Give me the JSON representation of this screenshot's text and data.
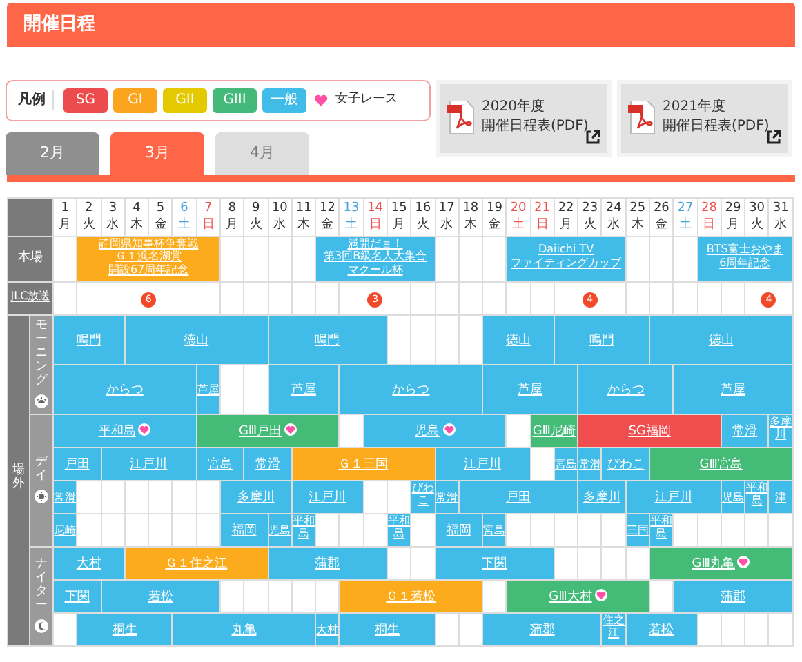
{
  "page_title": "開催日程",
  "legend": {
    "label": "凡例",
    "grades": [
      {
        "label": "SG",
        "color": "#ec4c4e"
      },
      {
        "label": "GI",
        "color": "#fba41e"
      },
      {
        "label": "GII",
        "color": "#e4c900"
      },
      {
        "label": "GIII",
        "color": "#45b97a"
      },
      {
        "label": "一般",
        "color": "#41bbe8"
      }
    ],
    "ladies": "女子レース"
  },
  "pdf_links": [
    {
      "year": "2020年度",
      "label": "開催日程表(PDF)"
    },
    {
      "year": "2021年度",
      "label": "開催日程表(PDF)"
    }
  ],
  "month_tabs": [
    {
      "label": "2月",
      "selected": false,
      "disabled": false
    },
    {
      "label": "3月",
      "selected": true,
      "disabled": false
    },
    {
      "label": "4月",
      "selected": false,
      "disabled": true
    }
  ],
  "days": [
    {
      "day": "1",
      "weekday": "月",
      "kind": "weekday"
    },
    {
      "day": "2",
      "weekday": "火",
      "kind": "weekday"
    },
    {
      "day": "3",
      "weekday": "水",
      "kind": "weekday"
    },
    {
      "day": "4",
      "weekday": "木",
      "kind": "weekday"
    },
    {
      "day": "5",
      "weekday": "金",
      "kind": "weekday"
    },
    {
      "day": "6",
      "weekday": "土",
      "kind": "saturday"
    },
    {
      "day": "7",
      "weekday": "日",
      "kind": "holiday"
    },
    {
      "day": "8",
      "weekday": "月",
      "kind": "weekday"
    },
    {
      "day": "9",
      "weekday": "火",
      "kind": "weekday"
    },
    {
      "day": "10",
      "weekday": "水",
      "kind": "weekday"
    },
    {
      "day": "11",
      "weekday": "木",
      "kind": "weekday"
    },
    {
      "day": "12",
      "weekday": "金",
      "kind": "weekday"
    },
    {
      "day": "13",
      "weekday": "土",
      "kind": "saturday"
    },
    {
      "day": "14",
      "weekday": "日",
      "kind": "holiday"
    },
    {
      "day": "15",
      "weekday": "月",
      "kind": "weekday"
    },
    {
      "day": "16",
      "weekday": "火",
      "kind": "weekday"
    },
    {
      "day": "17",
      "weekday": "水",
      "kind": "weekday"
    },
    {
      "day": "18",
      "weekday": "木",
      "kind": "weekday"
    },
    {
      "day": "19",
      "weekday": "金",
      "kind": "weekday"
    },
    {
      "day": "20",
      "weekday": "土",
      "kind": "holiday"
    },
    {
      "day": "21",
      "weekday": "日",
      "kind": "holiday"
    },
    {
      "day": "22",
      "weekday": "月",
      "kind": "weekday"
    },
    {
      "day": "23",
      "weekday": "火",
      "kind": "weekday"
    },
    {
      "day": "24",
      "weekday": "水",
      "kind": "weekday"
    },
    {
      "day": "25",
      "weekday": "木",
      "kind": "weekday"
    },
    {
      "day": "26",
      "weekday": "金",
      "kind": "weekday"
    },
    {
      "day": "27",
      "weekday": "土",
      "kind": "saturday"
    },
    {
      "day": "28",
      "weekday": "日",
      "kind": "holiday"
    },
    {
      "day": "29",
      "weekday": "月",
      "kind": "weekday"
    },
    {
      "day": "30",
      "weekday": "火",
      "kind": "weekday"
    },
    {
      "day": "31",
      "weekday": "水",
      "kind": "weekday"
    }
  ],
  "home": {
    "label": "本場",
    "cells": [
      "",
      {
        "colspan": 6,
        "kind": "gi",
        "lines": [
          "静岡県知事杯争奪戦",
          "Ｇ１浜名湖賞",
          "開設67周年記念"
        ]
      },
      "",
      "",
      "",
      "",
      {
        "colspan": 5,
        "kind": "general",
        "lines": [
          "満開だョ！",
          "第3回B級名人大集合",
          "マクール杯"
        ]
      },
      "",
      "",
      "",
      {
        "colspan": 5,
        "kind": "general",
        "lines": [
          "Daiichi TV",
          "ファイティングカップ"
        ]
      },
      "",
      "",
      "",
      {
        "colspan": 4,
        "kind": "general",
        "lines": [
          "BTS富士おやま",
          "6周年記念"
        ]
      }
    ]
  },
  "jlc": {
    "label": "JLC放送",
    "cells": [
      "",
      {
        "colspan": 6,
        "channel": "6"
      },
      "",
      "",
      "",
      "",
      "",
      {
        "colspan": 3,
        "channel": "3"
      },
      "",
      "",
      "",
      "",
      "",
      "",
      {
        "colspan": 3,
        "channel": "4"
      },
      "",
      "",
      "",
      "",
      "",
      {
        "colspan": 2,
        "channel": "4"
      }
    ]
  },
  "outside": {
    "label": "場外",
    "sessions": [
      {
        "label": "モーニング",
        "kind": "morning",
        "rows": [
          [
            {
              "colspan": 3,
              "name": "鳴門",
              "kind": "general",
              "ladies": false
            },
            {
              "colspan": 6,
              "name": "徳山",
              "kind": "general",
              "ladies": false
            },
            {
              "colspan": 5,
              "name": "鳴門",
              "kind": "general",
              "ladies": false
            },
            "",
            "",
            "",
            "",
            {
              "colspan": 3,
              "name": "徳山",
              "kind": "general",
              "ladies": false
            },
            {
              "colspan": 4,
              "name": "鳴門",
              "kind": "general",
              "ladies": false
            },
            {
              "colspan": 6,
              "name": "徳山",
              "kind": "general",
              "ladies": false
            }
          ],
          [
            {
              "colspan": 6,
              "name": "からつ",
              "kind": "general",
              "ladies": false
            },
            {
              "name": "芦屋",
              "kind": "general",
              "ladies": false
            },
            "",
            "",
            {
              "colspan": 3,
              "name": "芦屋",
              "kind": "general",
              "ladies": false
            },
            {
              "colspan": 6,
              "name": "からつ",
              "kind": "general",
              "ladies": false
            },
            {
              "colspan": 4,
              "name": "芦屋",
              "kind": "general",
              "ladies": false
            },
            {
              "colspan": 4,
              "name": "からつ",
              "kind": "general",
              "ladies": false
            },
            {
              "colspan": 5,
              "name": "芦屋",
              "kind": "general",
              "ladies": false
            }
          ]
        ]
      },
      {
        "label": "デイ",
        "kind": "day",
        "rows": [
          [
            {
              "colspan": 6,
              "name": "平和島",
              "kind": "general",
              "ladies": true
            },
            {
              "colspan": 6,
              "name": "GⅢ戸田",
              "kind": "giii",
              "ladies": true
            },
            "",
            {
              "colspan": 6,
              "name": "児島",
              "kind": "general",
              "ladies": true
            },
            "",
            {
              "colspan": 2,
              "name": "GⅢ尼崎",
              "kind": "giii",
              "ladies": false
            },
            {
              "colspan": 6,
              "name": "SG福岡",
              "kind": "sg",
              "ladies": false
            },
            {
              "colspan": 2,
              "name": "常滑",
              "kind": "general",
              "ladies": false
            },
            {
              "name": "多摩川",
              "kind": "general",
              "ladies": false
            }
          ],
          [
            {
              "colspan": 2,
              "name": "戸田",
              "kind": "general",
              "ladies": false
            },
            {
              "colspan": 4,
              "name": "江戸川",
              "kind": "general",
              "ladies": false
            },
            {
              "colspan": 2,
              "name": "宮島",
              "kind": "general",
              "ladies": false
            },
            {
              "colspan": 2,
              "name": "常滑",
              "kind": "general",
              "ladies": false
            },
            {
              "colspan": 6,
              "name": "Ｇ１三国",
              "kind": "gi",
              "ladies": false
            },
            {
              "colspan": 4,
              "name": "江戸川",
              "kind": "general",
              "ladies": false
            },
            "",
            {
              "name": "宮島",
              "kind": "general",
              "ladies": false
            },
            {
              "name": "常滑",
              "kind": "general",
              "ladies": false
            },
            {
              "colspan": 2,
              "name": "びわこ",
              "kind": "general",
              "ladies": false
            },
            {
              "colspan": 6,
              "name": "GⅢ宮島",
              "kind": "giii",
              "ladies": false
            }
          ],
          [
            {
              "name": "常滑",
              "kind": "general",
              "ladies": false
            },
            "",
            "",
            "",
            "",
            "",
            "",
            {
              "colspan": 3,
              "name": "多摩川",
              "kind": "general",
              "ladies": false
            },
            {
              "colspan": 3,
              "name": "江戸川",
              "kind": "general",
              "ladies": false
            },
            "",
            "",
            {
              "name": "びわこ",
              "kind": "general",
              "ladies": false
            },
            {
              "name": "常滑",
              "kind": "general",
              "ladies": false
            },
            {
              "colspan": 5,
              "name": "戸田",
              "kind": "general",
              "ladies": false
            },
            {
              "colspan": 2,
              "name": "多摩川",
              "kind": "general",
              "ladies": false
            },
            {
              "colspan": 4,
              "name": "江戸川",
              "kind": "general",
              "ladies": false
            },
            {
              "name": "児島",
              "kind": "general",
              "ladies": false
            },
            {
              "name": "平和島",
              "kind": "general",
              "ladies": false
            },
            {
              "name": "津",
              "kind": "general",
              "ladies": false
            }
          ],
          [
            {
              "name": "尼崎",
              "kind": "general",
              "ladies": false
            },
            "",
            "",
            "",
            "",
            "",
            "",
            {
              "colspan": 2,
              "name": "福岡",
              "kind": "general",
              "ladies": false
            },
            {
              "name": "児島",
              "kind": "general",
              "ladies": false
            },
            {
              "name": "平和島",
              "kind": "general",
              "ladies": false
            },
            "",
            "",
            "",
            {
              "name": "平和島",
              "kind": "general",
              "ladies": false
            },
            "",
            {
              "colspan": 2,
              "name": "福岡",
              "kind": "general",
              "ladies": false
            },
            {
              "name": "宮島",
              "kind": "general",
              "ladies": false
            },
            "",
            "",
            "",
            "",
            "",
            {
              "name": "三国",
              "kind": "general",
              "ladies": false
            },
            {
              "name": "平和島",
              "kind": "general",
              "ladies": false
            },
            "",
            "",
            "",
            "",
            ""
          ]
        ]
      },
      {
        "label": "ナイター",
        "kind": "night",
        "rows": [
          [
            {
              "colspan": 3,
              "name": "大村",
              "kind": "general",
              "ladies": false
            },
            {
              "colspan": 6,
              "name": "Ｇ１住之江",
              "kind": "gi",
              "ladies": false
            },
            {
              "colspan": 5,
              "name": "蒲郡",
              "kind": "general",
              "ladies": false
            },
            "",
            "",
            {
              "colspan": 5,
              "name": "下関",
              "kind": "general",
              "ladies": false
            },
            "",
            "",
            "",
            "",
            {
              "colspan": 6,
              "name": "GⅢ丸亀",
              "kind": "giii",
              "ladies": true
            }
          ],
          [
            {
              "colspan": 2,
              "name": "下関",
              "kind": "general",
              "ladies": false
            },
            {
              "colspan": 5,
              "name": "若松",
              "kind": "general",
              "ladies": false
            },
            "",
            "",
            "",
            "",
            "",
            {
              "colspan": 6,
              "name": "Ｇ１若松",
              "kind": "gi",
              "ladies": false
            },
            "",
            {
              "colspan": 6,
              "name": "GⅢ大村",
              "kind": "giii",
              "ladies": true
            },
            "",
            {
              "colspan": 5,
              "name": "蒲郡",
              "kind": "general",
              "ladies": false
            }
          ],
          [
            "",
            {
              "colspan": 4,
              "name": "桐生",
              "kind": "general",
              "ladies": false
            },
            {
              "colspan": 6,
              "name": "丸亀",
              "kind": "general",
              "ladies": false
            },
            {
              "name": "大村",
              "kind": "general",
              "ladies": false
            },
            {
              "colspan": 4,
              "name": "桐生",
              "kind": "general",
              "ladies": false
            },
            "",
            "",
            {
              "colspan": 5,
              "name": "蒲郡",
              "kind": "general",
              "ladies": false
            },
            {
              "name": "住之江",
              "kind": "general",
              "ladies": false
            },
            {
              "colspan": 3,
              "name": "若松",
              "kind": "general",
              "ladies": false
            },
            "",
            "",
            "",
            ""
          ]
        ]
      }
    ]
  }
}
